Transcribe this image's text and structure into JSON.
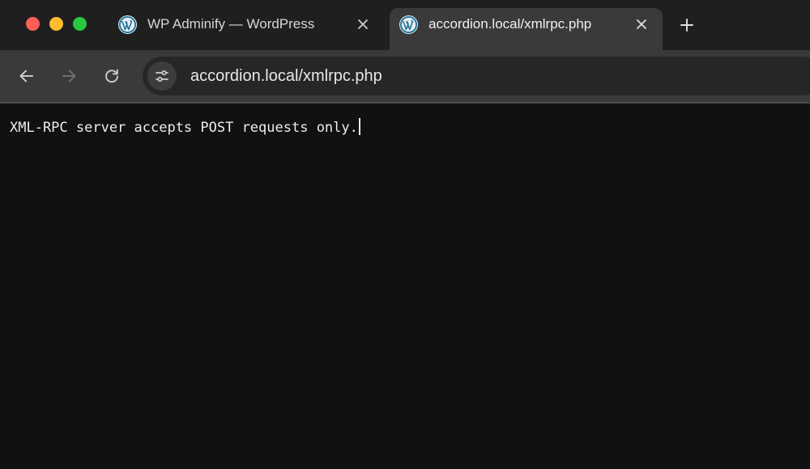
{
  "window_controls": {
    "close_color": "#ff5f57",
    "minimize_color": "#febc2e",
    "maximize_color": "#28c840"
  },
  "tabs": [
    {
      "title": "WP Adminify — WordPress",
      "icon": "wordpress-icon",
      "active": false
    },
    {
      "title": "accordion.local/xmlrpc.php",
      "icon": "wordpress-icon",
      "active": true
    }
  ],
  "toolbar": {
    "back_icon": "arrow-left-icon",
    "forward_icon": "arrow-right-icon",
    "reload_icon": "reload-icon",
    "site_info_icon": "tune-icon",
    "url": "accordion.local/xmlrpc.php"
  },
  "page": {
    "message": "XML-RPC server accepts POST requests only."
  }
}
